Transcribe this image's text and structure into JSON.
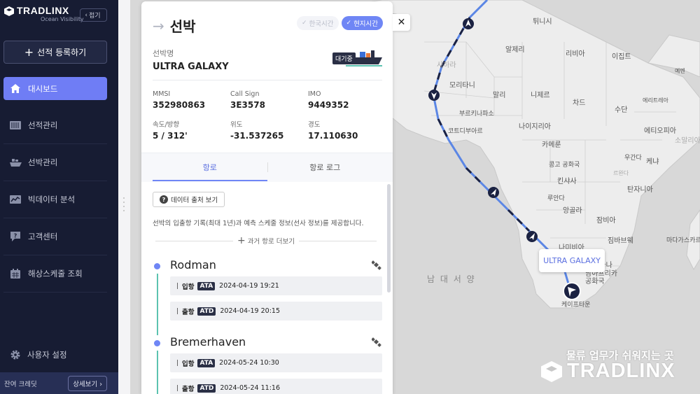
{
  "sidebar": {
    "logo_name": "TRADLINX",
    "logo_sub": "Ocean Visibility",
    "collapse_label": "접기",
    "register_label": "선적 등록하기",
    "items": [
      {
        "label": "대시보드",
        "icon": "home-icon",
        "active": true
      },
      {
        "label": "선적관리",
        "icon": "container-icon"
      },
      {
        "label": "선박관리",
        "icon": "ship-icon"
      },
      {
        "label": "빅데이터 분석",
        "icon": "chart-icon"
      },
      {
        "label": "고객센터",
        "icon": "help-icon"
      },
      {
        "label": "해상스케줄 조회",
        "icon": "calendar-icon"
      }
    ],
    "settings_label": "사용자 설정",
    "credit_label": "잔여 크레딧",
    "detail_label": "상세보기"
  },
  "panel": {
    "title": "선박",
    "time_korea": "한국시간",
    "time_local": "현지시간",
    "ship_name_label": "선박명",
    "ship_name": "ULTRA GALAXY",
    "status_badge": "대기중",
    "info": {
      "mmsi_label": "MMSI",
      "mmsi": "352980863",
      "callsign_label": "Call Sign",
      "callsign": "3E3578",
      "imo_label": "IMO",
      "imo": "9449352",
      "speed_label": "속도/방향",
      "speed": "5 / 312'",
      "lat_label": "위도",
      "lat": "-31.537265",
      "lng_label": "경도",
      "lng": "17.110630"
    },
    "tabs": [
      "항로",
      "항로 로그"
    ],
    "source_btn": "데이터 출처 보기",
    "route_desc": "선박의 입출항 기록(최대 1년)과 예측 스케줄 정보(선사 정보)를 제공합니다.",
    "more_past": "과거 항로 더보기",
    "ports": [
      {
        "name": "Rodman",
        "events": [
          {
            "label": "입항",
            "tag": "ATA",
            "time": "2024-04-19 19:21"
          },
          {
            "label": "출항",
            "tag": "ATD",
            "time": "2024-04-19 20:15"
          }
        ]
      },
      {
        "name": "Bremerhaven",
        "events": [
          {
            "label": "입항",
            "tag": "ATA",
            "time": "2024-05-24 10:30"
          },
          {
            "label": "출항",
            "tag": "ATD",
            "time": "2024-05-24 11:16"
          }
        ]
      }
    ]
  },
  "map": {
    "tooltip": "ULTRA GALAXY",
    "labels": [
      "튀니시",
      "알제리",
      "리비아",
      "이집트",
      "사하라",
      "모리타니",
      "말리",
      "니제르",
      "차드",
      "수단",
      "에리트레아",
      "부르키나파소",
      "나이지리아",
      "에티오피아",
      "코트디부아르",
      "카메룬",
      "우간다",
      "케냐",
      "콩고 공화국",
      "탄자니아",
      "킨샤사",
      "루안다",
      "앙골라",
      "잠비아",
      "나미비아",
      "짐바브웨",
      "보츠와나",
      "마다가스카르",
      "남아프리카 공화국",
      "케이프타운",
      "남 대 서 양",
      "소말리아",
      "예멘",
      "르완다"
    ],
    "watermark_tag": "물류 업무가 쉬워지는 곳",
    "watermark_logo": "TRADLINX",
    "colors": {
      "route_past": "#1b2242",
      "route_future": "#5b86e5",
      "accent": "#6f86f5",
      "land": "#ededed",
      "sea": "#d8d8d8"
    }
  }
}
